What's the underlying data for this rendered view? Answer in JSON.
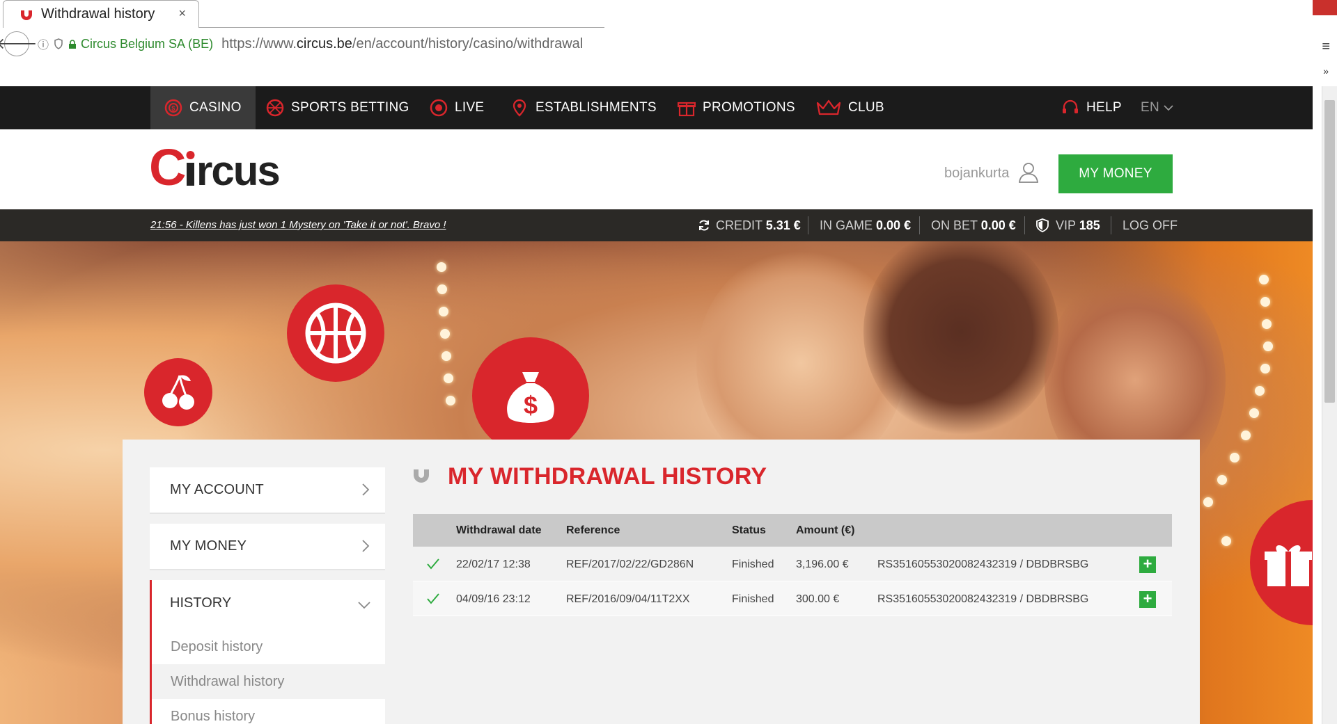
{
  "browser": {
    "tab_title": "Withdrawal history",
    "tab_close": "×",
    "site_identity": "Circus Belgium SA (BE)",
    "url_prefix": "https://www.",
    "url_domain": "circus.be",
    "url_path": "/en/account/history/casino/withdrawal",
    "back_glyph": "🡐",
    "info_glyph": "ⓘ",
    "menu_glyph": "≡",
    "overflow_glyph": "»"
  },
  "nav": {
    "items": [
      {
        "label": "CASINO",
        "icon": "casino-chip-icon"
      },
      {
        "label": "SPORTS BETTING",
        "icon": "ball-icon"
      },
      {
        "label": "LIVE",
        "icon": "live-icon"
      },
      {
        "label": "ESTABLISHMENTS",
        "icon": "location-pin-icon"
      },
      {
        "label": "PROMOTIONS",
        "icon": "gift-icon"
      },
      {
        "label": "CLUB",
        "icon": "crown-icon"
      }
    ],
    "help": "HELP",
    "lang": "EN"
  },
  "header": {
    "logo_text": "Circus",
    "username": "bojankurta",
    "my_money_button": "MY MONEY"
  },
  "status": {
    "ticker": "21:56 - Killens has just won 1 Mystery on 'Take it or not'. Bravo !",
    "credit_label": "CREDIT",
    "credit_value": "5.31 €",
    "ingame_label": "IN GAME",
    "ingame_value": "0.00 €",
    "onbet_label": "ON BET",
    "onbet_value": "0.00 €",
    "vip_label": "VIP",
    "vip_value": "185",
    "logoff": "LOG OFF"
  },
  "sidebar": {
    "my_account": "MY ACCOUNT",
    "my_money": "MY MONEY",
    "history": "HISTORY",
    "sub_items": [
      "Deposit history",
      "Withdrawal history",
      "Bonus history"
    ]
  },
  "main": {
    "title": "MY WITHDRAWAL HISTORY",
    "columns": [
      "Withdrawal date",
      "Reference",
      "Status",
      "Amount (€)"
    ],
    "rows": [
      {
        "date": "22/02/17 12:38",
        "reference": "REF/2017/02/22/GD286N",
        "status": "Finished",
        "amount": "3,196.00 €",
        "account": "RS35160553020082432319 / DBDBRSBG",
        "expand": "+"
      },
      {
        "date": "04/09/16 23:12",
        "reference": "REF/2016/09/04/11T2XX",
        "status": "Finished",
        "amount": "300.00 €",
        "account": "RS35160553020082432319 / DBDBRSBG",
        "expand": "+"
      }
    ]
  },
  "colors": {
    "brand_red": "#d9262c",
    "accent_green": "#2eab3f",
    "nav_bg": "#1b1b1b"
  }
}
